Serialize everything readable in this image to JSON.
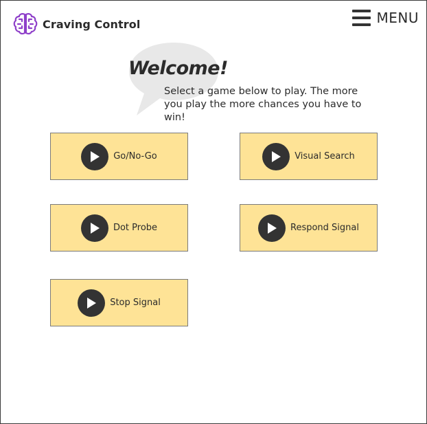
{
  "header": {
    "app_name": "Craving Control",
    "logo_icon": "brain-icon",
    "menu_label": "MENU",
    "menu_icon": "hamburger-icon"
  },
  "welcome": {
    "title": "Welcome!",
    "message": "Select a game below to play. The more you play the more chances you have to win!"
  },
  "games": [
    {
      "label": "Go/No-Go",
      "icon": "play-icon"
    },
    {
      "label": "Visual Search",
      "icon": "play-icon"
    },
    {
      "label": "Dot Probe",
      "icon": "play-icon"
    },
    {
      "label": "Respond Signal",
      "icon": "play-icon"
    },
    {
      "label": "Stop Signal",
      "icon": "play-icon"
    }
  ],
  "colors": {
    "button_fill": "#fee396",
    "brand_purple": "#8e3fc9",
    "dark": "#333333",
    "bubble": "#e8e8e8"
  }
}
